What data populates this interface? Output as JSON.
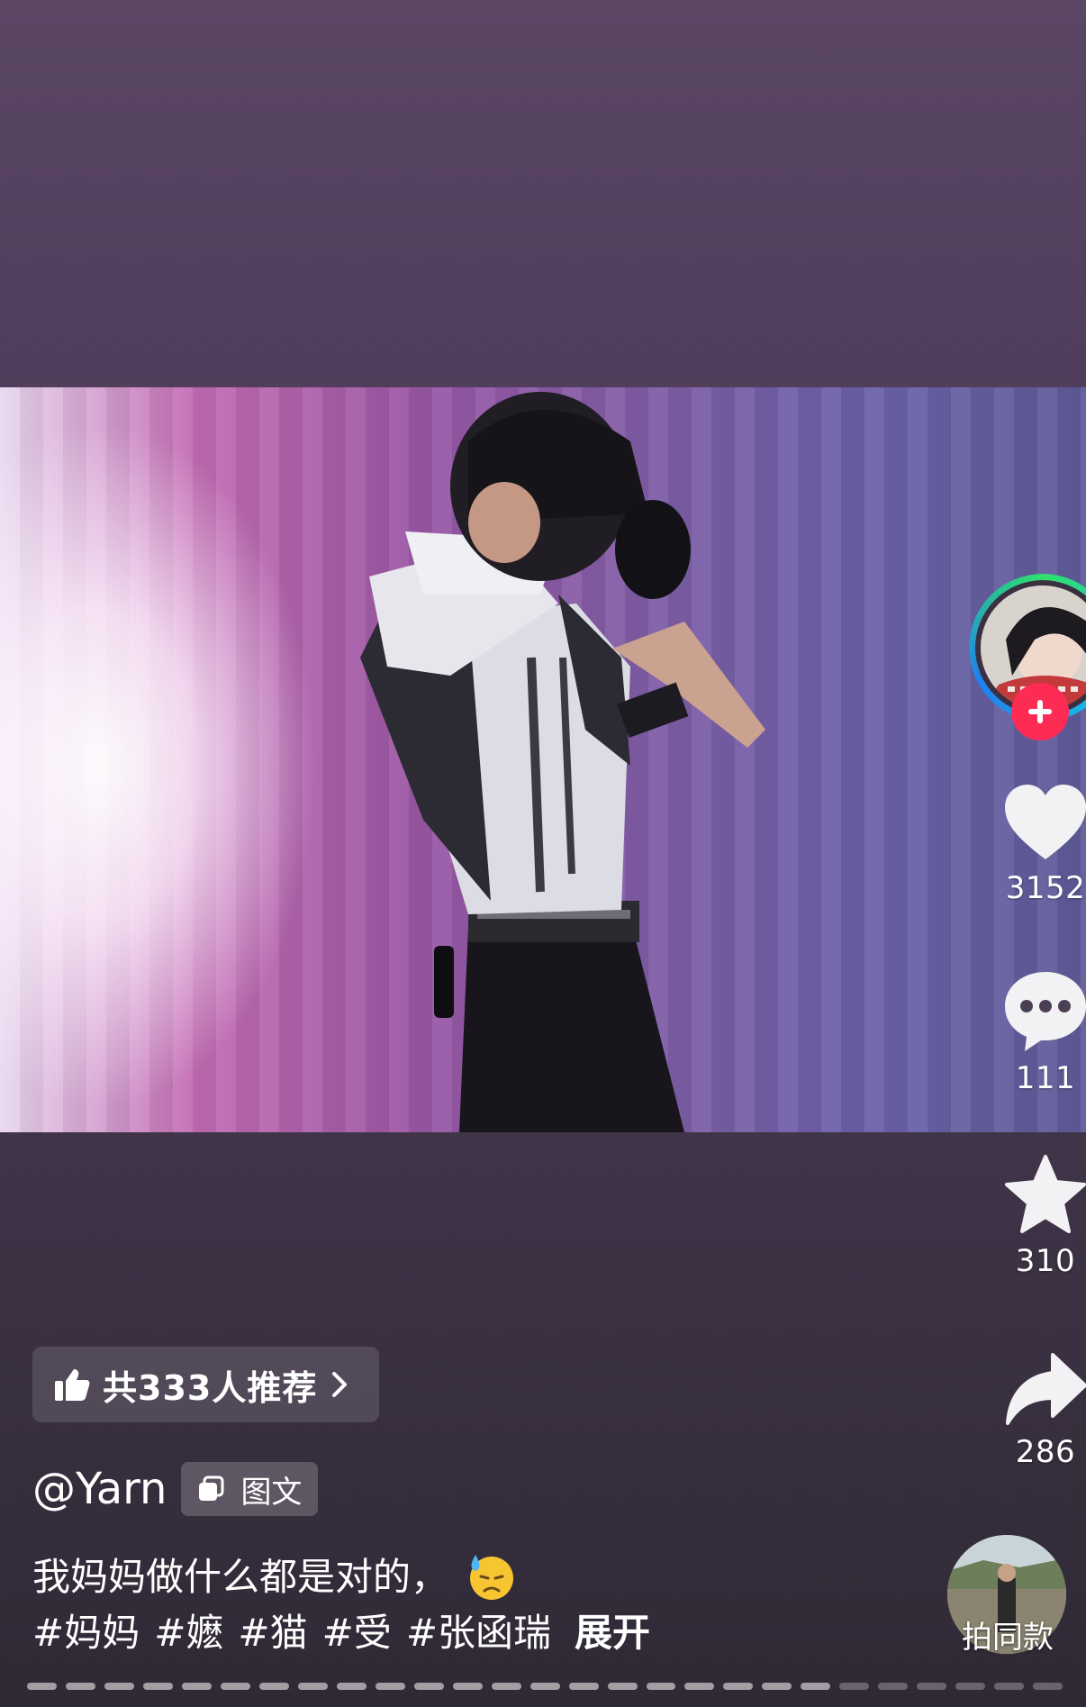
{
  "post": {
    "author": "@Yarn",
    "type_label": "图文",
    "recommend_label": "共333人推荐",
    "caption_text": "我妈妈做什么都是对的，",
    "hashtags": [
      "#妈妈",
      "#嬷",
      "#猫",
      "#受",
      "#张函瑞"
    ],
    "expand_label": "展开"
  },
  "actions": {
    "likes": "3152",
    "comments": "111",
    "favorites": "310",
    "shares": "286"
  },
  "same_style_label": "拍同款",
  "icons": {
    "like": "heart-icon",
    "comment": "comment-bubble-icon",
    "favorite": "star-icon",
    "share": "share-arrow-icon",
    "follow": "plus-icon",
    "recommend": "thumbs-up-icon",
    "type": "image-text-icon",
    "emoji": "downcast-face-with-sweat-emoji"
  },
  "colors": {
    "follow_button": "#fe2c55",
    "avatar_ring": "#19c3e8"
  },
  "progress": {
    "total_segments": 27,
    "current_segment": 21
  }
}
